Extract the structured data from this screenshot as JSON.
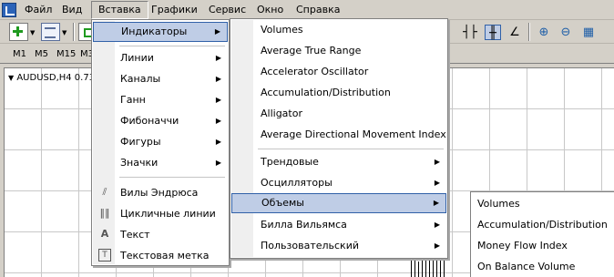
{
  "menubar": {
    "items": [
      "Файл",
      "Вид",
      "Вставка",
      "Графики",
      "Сервис",
      "Окно",
      "Справка"
    ]
  },
  "timeframes": [
    "M1",
    "M5",
    "M15",
    "M3"
  ],
  "chart": {
    "title": "AUDUSD,H4  0.73"
  },
  "insert_menu": {
    "items": [
      {
        "label": "Индикаторы"
      },
      {
        "label": "Линии"
      },
      {
        "label": "Каналы"
      },
      {
        "label": "Ганн"
      },
      {
        "label": "Фибоначчи"
      },
      {
        "label": "Фигуры"
      },
      {
        "label": "Значки"
      },
      {
        "label": "Вилы Эндрюса"
      },
      {
        "label": "Цикличные линии"
      },
      {
        "label": "Текст"
      },
      {
        "label": "Текстовая метка"
      }
    ]
  },
  "indicators_menu": {
    "items": [
      {
        "label": "Volumes"
      },
      {
        "label": "Average True Range"
      },
      {
        "label": "Accelerator Oscillator"
      },
      {
        "label": "Accumulation/Distribution"
      },
      {
        "label": "Alligator"
      },
      {
        "label": "Average Directional Movement Index"
      },
      {
        "label": "Трендовые"
      },
      {
        "label": "Осцилляторы"
      },
      {
        "label": "Объемы"
      },
      {
        "label": "Билла Вильямса"
      },
      {
        "label": "Пользовательский"
      }
    ]
  },
  "volumes_menu": {
    "items": [
      {
        "label": "Volumes"
      },
      {
        "label": "Accumulation/Distribution"
      },
      {
        "label": "Money Flow Index"
      },
      {
        "label": "On Balance Volume"
      }
    ]
  },
  "colors": {
    "highlight": "#bfcde6",
    "highlight_border": "#3161a8",
    "plus_green": "#1f9a1f"
  }
}
